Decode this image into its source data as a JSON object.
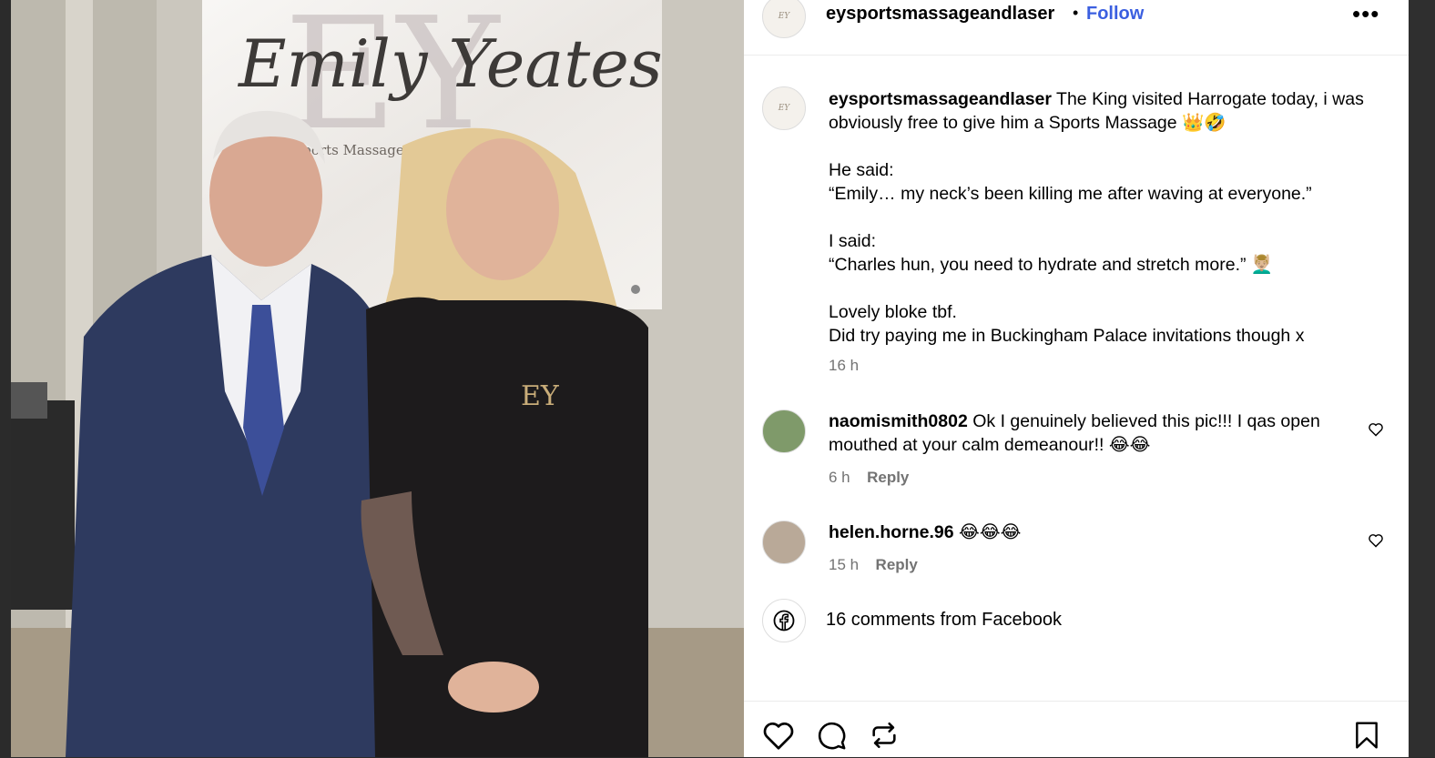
{
  "post": {
    "username": "eysportsmassageandlaser",
    "follow_label": "Follow",
    "separator": "•",
    "more_label": "•••",
    "photo_sign_script": "Emily Yeates",
    "photo_sign_letters": "EY",
    "photo_sign_sub": "Sports Massage & Laser",
    "shirt_logo": "EY"
  },
  "caption": {
    "username": "eysportsmassageandlaser",
    "line1": "The King visited Harrogate today, i was obviously free to give him a Sports Massage 👑🤣",
    "line2": "He said:",
    "line3": "“Emily… my neck’s been killing me after waving at everyone.”",
    "line4": "I said:",
    "line5": "“Charles hun, you need to hydrate and stretch more.” 💆🏼‍♂️",
    "line6": "Lovely bloke tbf.",
    "line7": "Did try paying me in Buckingham Palace invitations though x",
    "time": "16 h"
  },
  "comments": [
    {
      "username": "naomismith0802",
      "text": "Ok I genuinely believed this pic!!! I qas open mouthed at your calm demeanour!! 😂😂",
      "time": "6 h",
      "reply_label": "Reply"
    },
    {
      "username": "helen.horne.96",
      "text": "😂😂😂",
      "time": "15 h",
      "reply_label": "Reply"
    }
  ],
  "facebook": {
    "text": "16 comments from Facebook",
    "icon": "facebook-icon"
  },
  "actions": {
    "icons": [
      "heart-icon",
      "comment-icon",
      "repost-icon",
      "bookmark-icon"
    ]
  },
  "colors": {
    "accent": "#3b5fe0",
    "muted": "#737373"
  }
}
